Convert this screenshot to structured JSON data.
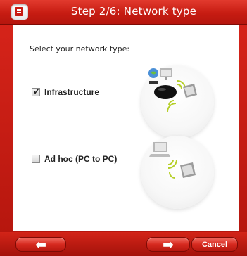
{
  "window": {
    "title": "Step 2/6: Network type"
  },
  "content": {
    "prompt": "Select your network type:",
    "options": [
      {
        "label": "Infrastructure",
        "checked": true
      },
      {
        "label": "Ad hoc (PC to PC)",
        "checked": false
      }
    ]
  },
  "footer": {
    "back_icon": "⬅",
    "next_icon": "➡",
    "cancel_label": "Cancel"
  },
  "colors": {
    "brand_red": "#c71c12",
    "wifi_green": "#b6cf2a"
  },
  "icons": {
    "app": "app-menu-icon",
    "back": "back-arrow-icon",
    "next": "next-arrow-icon"
  }
}
